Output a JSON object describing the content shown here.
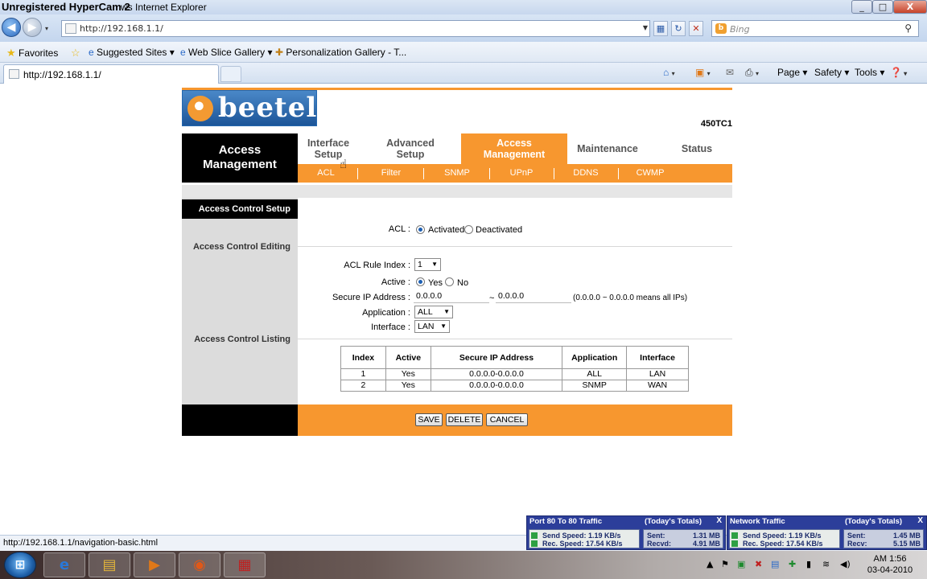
{
  "window": {
    "recorder_title": "Unregistered HyperCam 2",
    "ie_title": "ws Internet Explorer",
    "min": "_",
    "max": "□",
    "close": "X"
  },
  "address": {
    "url": "http://192.168.1.1/",
    "search_placeholder": "Bing"
  },
  "favorites": {
    "favorites_label": "Favorites",
    "suggested": "Suggested Sites ▾",
    "webslice": "Web Slice Gallery ▾",
    "personalization": "Personalization Gallery - T..."
  },
  "tab": {
    "title": "http://192.168.1.1/",
    "commands": {
      "page": "Page ▾",
      "safety": "Safety ▾",
      "tools": "Tools ▾"
    }
  },
  "router": {
    "brand": "beetel",
    "model": "450TC1",
    "side_title_line1": "Access",
    "side_title_line2": "Management",
    "main_tabs": [
      {
        "line1": "Interface",
        "line2": "Setup"
      },
      {
        "line1": "Advanced",
        "line2": "Setup"
      },
      {
        "line1": "Access",
        "line2": "Management"
      },
      {
        "line1": "Maintenance",
        "line2": ""
      },
      {
        "line1": "Status",
        "line2": ""
      }
    ],
    "sub_tabs": [
      "ACL",
      "Filter",
      "SNMP",
      "UPnP",
      "DDNS",
      "CWMP"
    ],
    "section_setup": "Access Control Setup",
    "section_editing": "Access Control Editing",
    "section_listing": "Access Control Listing",
    "acl": {
      "label": "ACL :",
      "opt_on": "Activated",
      "opt_off": "Deactivated",
      "selected": "Activated"
    },
    "editing": {
      "rule_index_label": "ACL Rule Index :",
      "rule_index_value": "1",
      "active_label": "Active :",
      "active_yes": "Yes",
      "active_no": "No",
      "active_selected": "Yes",
      "secure_ip_label": "Secure IP Address :",
      "ip_start": "0.0.0.0",
      "ip_sep": "~",
      "ip_end": "0.0.0.0",
      "ip_hint": "(0.0.0.0 ~ 0.0.0.0 means all IPs)",
      "application_label": "Application :",
      "application_value": "ALL",
      "interface_label": "Interface :",
      "interface_value": "LAN"
    },
    "listing": {
      "headers": [
        "Index",
        "Active",
        "Secure IP Address",
        "Application",
        "Interface"
      ],
      "rows": [
        [
          "1",
          "Yes",
          "0.0.0.0-0.0.0.0",
          "ALL",
          "LAN"
        ],
        [
          "2",
          "Yes",
          "0.0.0.0-0.0.0.0",
          "SNMP",
          "WAN"
        ]
      ]
    },
    "buttons": {
      "save": "SAVE",
      "delete": "DELETE",
      "cancel": "CANCEL"
    }
  },
  "status": {
    "text": "http://192.168.1.1/navigation-basic.html"
  },
  "widgets": [
    {
      "title": "Port 80 To 80 Traffic",
      "totals": "(Today's Totals)",
      "close": "X",
      "send": "Send Speed: 1.19 KB/s",
      "recv": "Rec. Speed: 17.54 KB/s",
      "sent_label": "Sent:",
      "sent_value": "1.31 MB",
      "recv_label": "Recvd:",
      "recv_value": "4.91 MB"
    },
    {
      "title": "Network Traffic",
      "totals": "(Today's Totals)",
      "close": "X",
      "send": "Send Speed: 1.19 KB/s",
      "recv": "Rec. Speed: 17.54 KB/s",
      "sent_label": "Sent:",
      "sent_value": "1.45 MB",
      "recv_label": "Recv:",
      "recv_value": "5.15 MB"
    }
  ],
  "taskbar": {
    "time": "AM 1:56",
    "date": "03-04-2010"
  }
}
